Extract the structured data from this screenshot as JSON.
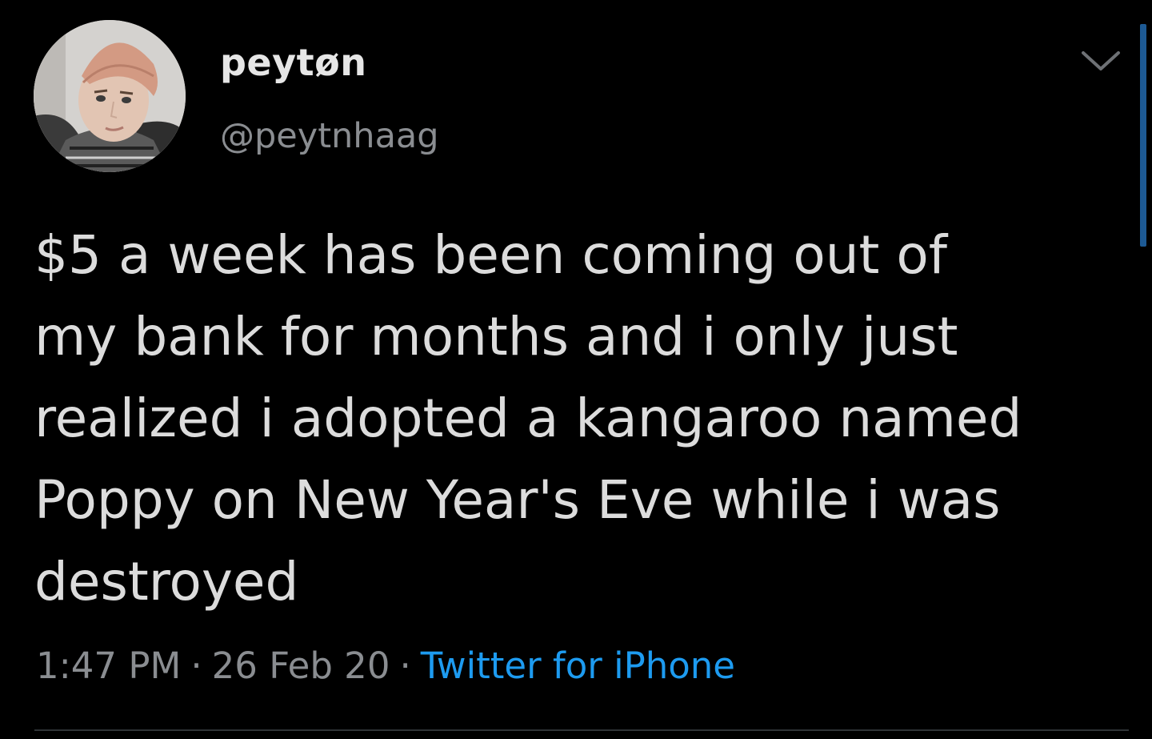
{
  "tweet": {
    "author": {
      "display_name": "peytøn",
      "handle": "@peytnhaag"
    },
    "text_lines": [
      "$5 a week has been coming out of",
      "my bank for months and i only just",
      "realized i adopted a kangaroo named",
      "Poppy on New Year's Eve while i was",
      "destroyed"
    ],
    "time": "1:47 PM",
    "date": "26 Feb 20",
    "separator": "·",
    "source": "Twitter for iPhone"
  },
  "icons": {
    "menu": "chevron-down-icon",
    "avatar": "profile-photo"
  },
  "colors": {
    "background": "#000000",
    "text": "#dcdcdc",
    "muted": "#8a8d91",
    "link": "#1d9bf0",
    "scrollbar": "#1d5a94"
  }
}
